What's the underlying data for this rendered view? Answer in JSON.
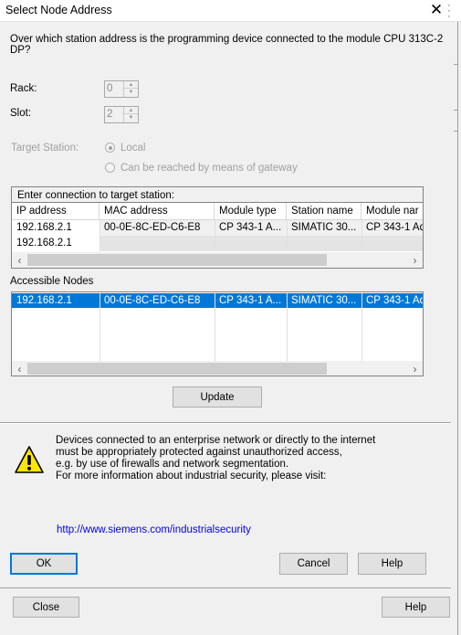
{
  "window": {
    "title": "Select Node Address",
    "close_icon": "close-icon"
  },
  "prompt": {
    "line1": "Over which station address is the programming device connected to the module CPU 313C-2",
    "line2": "DP?"
  },
  "rack": {
    "label": "Rack:",
    "value": "0"
  },
  "slot": {
    "label": "Slot:",
    "value": "2"
  },
  "target_station": {
    "label": "Target Station:",
    "local_label": "Local",
    "gateway_label": "Can be reached by means of gateway",
    "selected": "Local"
  },
  "connection_table": {
    "caption": "Enter connection to target station:",
    "columns": [
      "IP address",
      "MAC address",
      "Module type",
      "Station name",
      "Module nar"
    ],
    "rows": [
      [
        "192.168.2.1",
        "00-0E-8C-ED-C6-E8",
        "CP 343-1 A...",
        "SIMATIC 30...",
        "CP 343-1 Ad"
      ],
      [
        "192.168.2.1",
        "",
        "",
        "",
        ""
      ]
    ]
  },
  "accessible_nodes": {
    "label": "Accessible Nodes",
    "rows": [
      [
        "192.168.2.1",
        "00-0E-8C-ED-C6-E8",
        "CP 343-1 A...",
        "SIMATIC 30...",
        "CP 343-1 Ad"
      ]
    ],
    "selection_color": "#0078d7"
  },
  "buttons": {
    "update": "Update",
    "ok": "OK",
    "cancel": "Cancel",
    "help": "Help",
    "close": "Close",
    "help2": "Help"
  },
  "security_notice": {
    "icon": "warning-icon",
    "line1": "Devices connected to an enterprise network or directly to the internet",
    "line2": "must be appropriately  protected against unauthorized access,",
    "line3": "e.g. by use of firewalls and network segmentation.",
    "line4": "For more information about industrial security, please visit:",
    "link": "http://www.siemens.com/industrialsecurity"
  },
  "colors": {
    "link": "#0000ee",
    "warning_yellow": "#ffe600",
    "selection": "#0078d7"
  }
}
